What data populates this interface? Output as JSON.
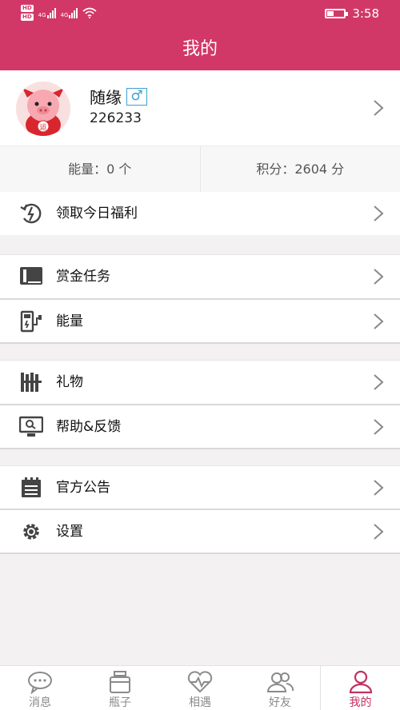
{
  "status_bar": {
    "time": "3:58"
  },
  "header": {
    "title": "我的"
  },
  "profile": {
    "username": "随缘",
    "gender_symbol": "♂",
    "user_id": "226233"
  },
  "stats": {
    "energy": "能量：0 个",
    "points": "积分：2604 分"
  },
  "menu": {
    "daily_welfare": "领取今日福利",
    "bounty_tasks": "赏金任务",
    "energy": "能量",
    "gifts": "礼物",
    "help_feedback": "帮助&反馈",
    "announcements": "官方公告",
    "settings": "设置"
  },
  "tabs": [
    "消息",
    "瓶子",
    "相遇",
    "好友",
    "我的"
  ],
  "colors": {
    "brand": "#d23867",
    "active_tab": "#c1305f",
    "gender": "#3c9fd6"
  }
}
